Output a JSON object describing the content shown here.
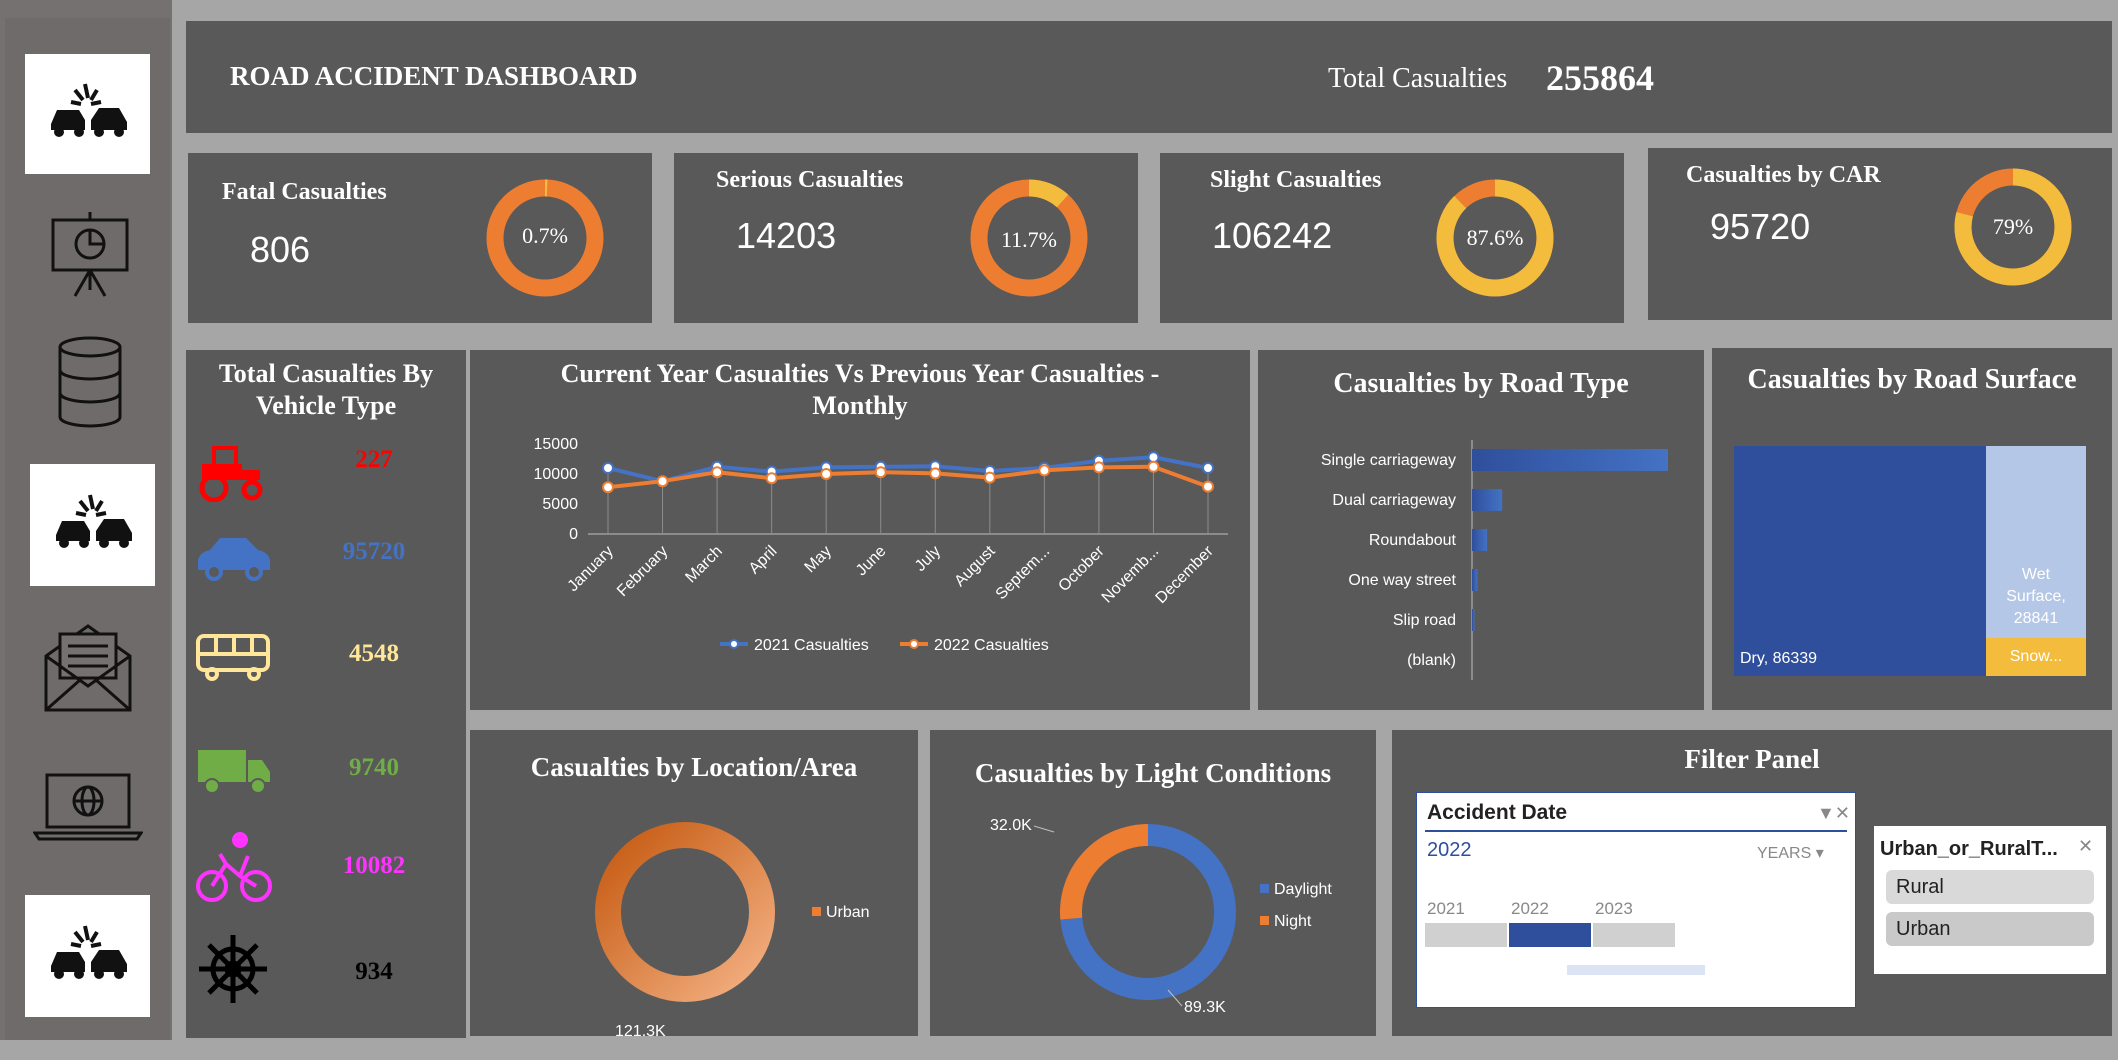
{
  "header": {
    "title": "ROAD ACCIDENT DASHBOARD",
    "total_label": "Total Casualties",
    "total_value": "255864"
  },
  "kpis": {
    "fatal": {
      "label": "Fatal Casualties",
      "value": "806",
      "pct_label": "0.7%",
      "pct": 0.7
    },
    "serious": {
      "label": "Serious Casualties",
      "value": "14203",
      "pct_label": "11.7%",
      "pct": 11.7
    },
    "slight": {
      "label": "Slight Casualties",
      "value": "106242",
      "pct_label": "87.6%",
      "pct": 87.6
    },
    "car": {
      "label": "Casualties by CAR",
      "value": "95720",
      "pct_label": "79%",
      "pct": 79
    }
  },
  "vehicle": {
    "title_line1": "Total Casualties By",
    "title_line2": "Vehicle Type",
    "items": [
      {
        "icon": "tractor-icon",
        "value": "227",
        "color": "#ff0000"
      },
      {
        "icon": "car-icon",
        "value": "95720",
        "color": "#4472c4"
      },
      {
        "icon": "bus-icon",
        "value": "4548",
        "color": "#ffe699"
      },
      {
        "icon": "truck-icon",
        "value": "9740",
        "color": "#70ad47"
      },
      {
        "icon": "bicycle-icon",
        "value": "10082",
        "color": "#ff33ff"
      },
      {
        "icon": "ship-wheel-icon",
        "value": "934",
        "color": "#000000"
      }
    ]
  },
  "colors": {
    "orange": "#ed7d31",
    "gold": "#f4bc3c",
    "blue": "#4472c4",
    "dark_blue": "#2f4f9c",
    "light_blue": "#b4c7e7",
    "panel": "#595959"
  },
  "chart_data": [
    {
      "type": "line",
      "title": "Current Year Casualties Vs Previous Year Casualties - Monthly",
      "categories": [
        "January",
        "February",
        "March",
        "April",
        "May",
        "June",
        "July",
        "August",
        "Septem...",
        "October",
        "Novemb...",
        "December"
      ],
      "y_ticks": [
        "15000",
        "10000",
        "5000",
        "0"
      ],
      "ylim": [
        0,
        15000
      ],
      "series": [
        {
          "name": "2021 Casualties",
          "color": "#4472c4",
          "values": [
            11000,
            8800,
            11200,
            10400,
            11100,
            11200,
            11300,
            10500,
            11000,
            12200,
            12800,
            11000
          ]
        },
        {
          "name": "2022 Casualties",
          "color": "#ed7d31",
          "values": [
            7800,
            8800,
            10300,
            9300,
            10000,
            10300,
            10100,
            9400,
            10600,
            11100,
            11200,
            7900
          ]
        }
      ],
      "legend": "bottom"
    },
    {
      "type": "bar",
      "title": "Casualties by Road Type",
      "categories": [
        "Single carriageway",
        "Dual carriageway",
        "Roundabout",
        "One way street",
        "Slip road",
        "(blank)"
      ],
      "values": [
        195000,
        30000,
        15000,
        5500,
        2500,
        0
      ],
      "orientation": "horizontal"
    },
    {
      "type": "treemap",
      "title": "Casualties by Road Surface",
      "items": [
        {
          "label": "Dry, 86339",
          "value": 86339,
          "color": "#2f4f9c"
        },
        {
          "label": "Wet Surface, 28841",
          "label_lines": [
            "Wet",
            "Surface,",
            "28841"
          ],
          "value": 28841,
          "color": "#b4c7e7"
        },
        {
          "label": "Snow...",
          "value": 3000,
          "color": "#f4bc3c"
        }
      ]
    },
    {
      "type": "pie",
      "title": "Casualties by Location/Area",
      "slices": [
        {
          "name": "Urban",
          "value": 121.3,
          "label": "121.3K",
          "color": "#ed7d31"
        }
      ],
      "legend": "right"
    },
    {
      "type": "pie",
      "title": "Casualties by Light Conditions",
      "slices": [
        {
          "name": "Daylight",
          "value": 89.3,
          "label": "89.3K",
          "color": "#4472c4"
        },
        {
          "name": "Night",
          "value": 32.0,
          "label": "32.0K",
          "color": "#ed7d31"
        }
      ],
      "legend": "right"
    }
  ],
  "filter": {
    "title": "Filter Panel",
    "date_slicer": {
      "title": "Accident Date",
      "selected": "2022",
      "level": "YEARS",
      "years": [
        "2021",
        "2022",
        "2023"
      ]
    },
    "area_slicer": {
      "title": "Urban_or_RuralT...",
      "options": [
        "Rural",
        "Urban"
      ]
    }
  }
}
